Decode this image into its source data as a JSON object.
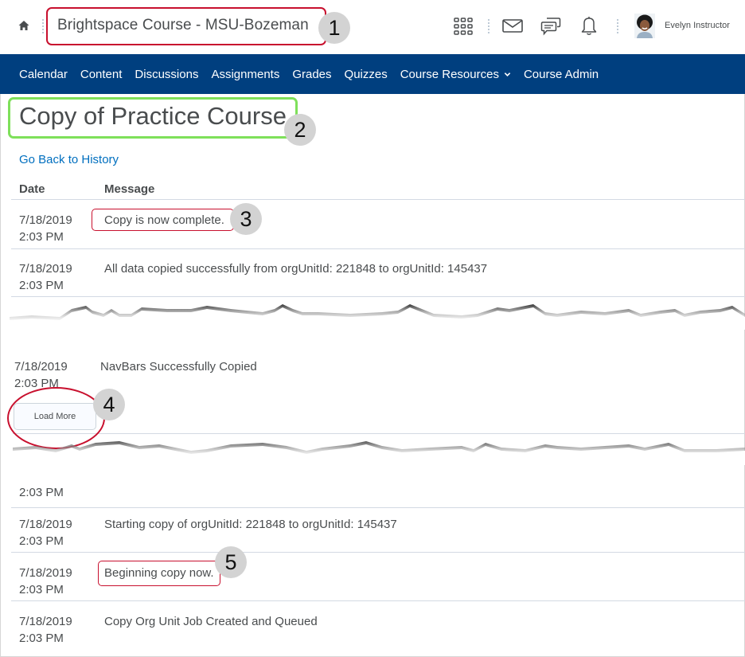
{
  "topbar": {
    "org_title": "Brightspace Course - MSU-Bozeman",
    "user_name": "Evelyn Instructor",
    "icons": [
      "home-icon",
      "waffle-grid-icon",
      "mail-icon",
      "chat-icon",
      "bell-icon"
    ]
  },
  "nav": {
    "items": [
      {
        "label": "Calendar"
      },
      {
        "label": "Content"
      },
      {
        "label": "Discussions"
      },
      {
        "label": "Assignments"
      },
      {
        "label": "Grades"
      },
      {
        "label": "Quizzes"
      },
      {
        "label": "Course Resources",
        "has_dropdown": true
      },
      {
        "label": "Course Admin"
      }
    ]
  },
  "page": {
    "title": "Copy of Practice Course",
    "back_link": "Go Back to History",
    "columns": {
      "date": "Date",
      "message": "Message"
    },
    "rows": [
      {
        "date": "7/18/2019",
        "time": "2:03 PM",
        "message": "Copy is now complete."
      },
      {
        "date": "7/18/2019",
        "time": "2:03 PM",
        "message": "All data copied successfully from orgUnitId: 221848 to orgUnitId: 145437"
      },
      {
        "date": "7/18/2019",
        "time": "2:03 PM",
        "message": "NavBars Successfully Copied"
      },
      {
        "date": "",
        "time": "2:03 PM",
        "message": ""
      },
      {
        "date": "7/18/2019",
        "time": "2:03 PM",
        "message": "Starting copy of orgUnitId: 221848 to orgUnitId: 145437"
      },
      {
        "date": "7/18/2019",
        "time": "2:03 PM",
        "message": "Beginning copy now."
      },
      {
        "date": "7/18/2019",
        "time": "2:03 PM",
        "message": "Copy Org Unit Job Created and Queued"
      }
    ],
    "load_more_label": "Load More"
  },
  "callouts": [
    "1",
    "2",
    "3",
    "4",
    "5"
  ],
  "colors": {
    "nav_bg": "#003f7f",
    "link": "#006fbf",
    "callout_red": "#c8102e",
    "callout_green": "#7ee05a",
    "badge_bg": "#d3d3d3"
  }
}
